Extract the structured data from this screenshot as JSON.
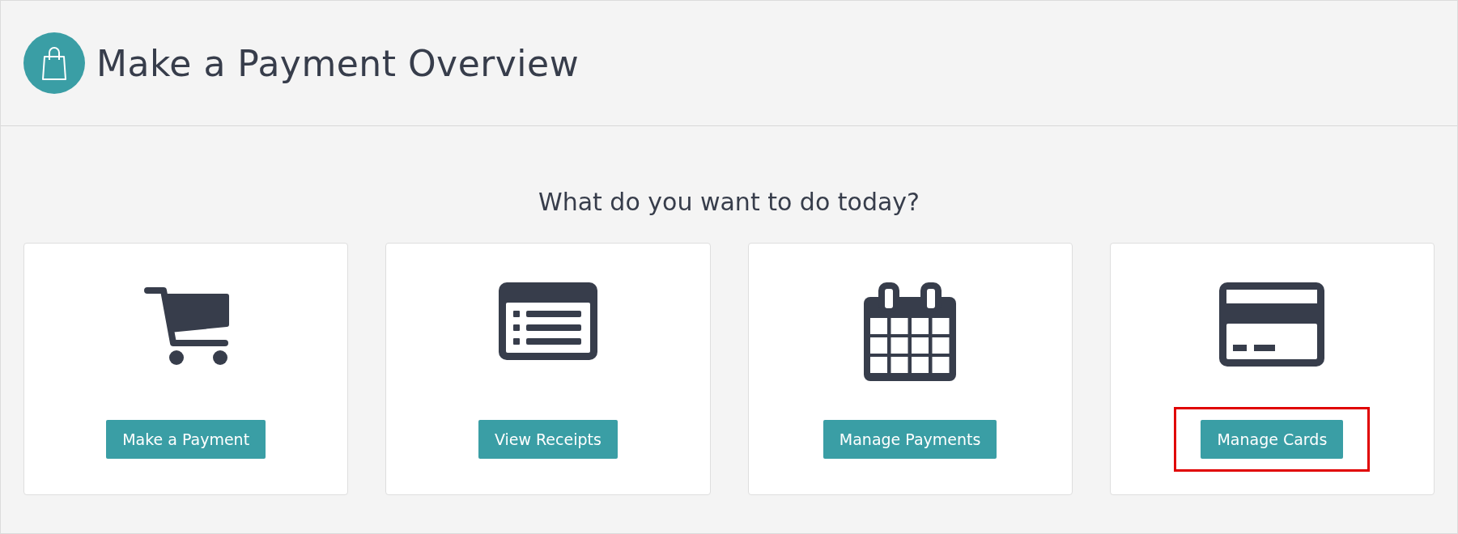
{
  "header": {
    "title": "Make a Payment Overview"
  },
  "prompt": "What do you want to do today?",
  "cards": [
    {
      "kind": "cart",
      "button": "Make a Payment",
      "highlighted": false
    },
    {
      "kind": "list",
      "button": "View Receipts",
      "highlighted": false
    },
    {
      "kind": "calendar",
      "button": "Manage Payments",
      "highlighted": false
    },
    {
      "kind": "card",
      "button": "Manage Cards",
      "highlighted": true
    }
  ]
}
